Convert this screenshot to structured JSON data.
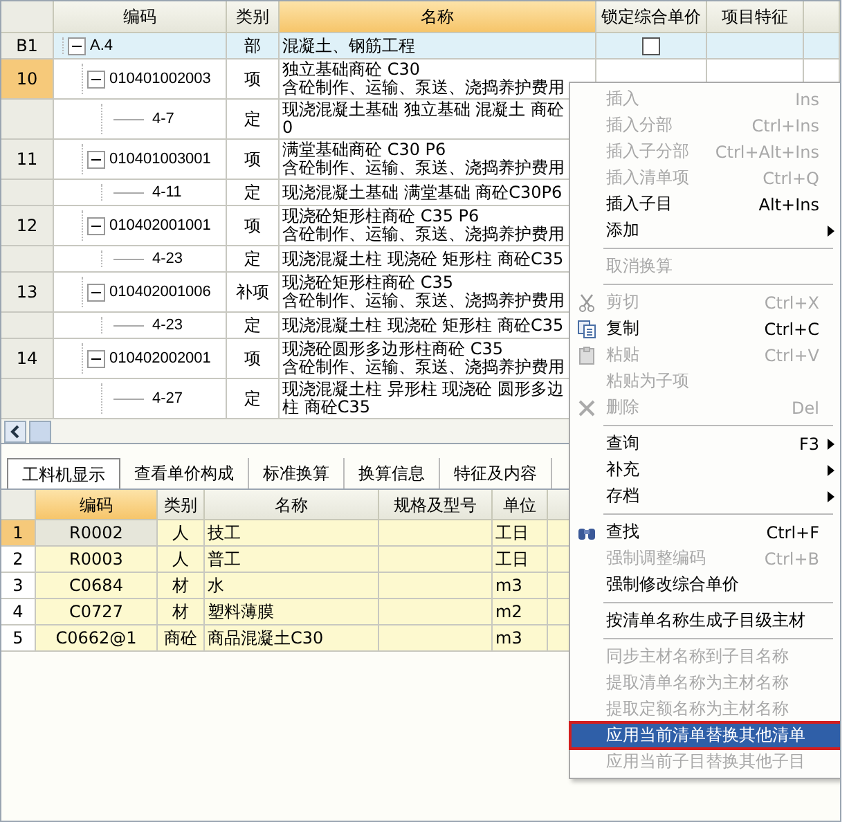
{
  "top_grid": {
    "columns": [
      {
        "label": "编码",
        "selected": false
      },
      {
        "label": "类别",
        "selected": false
      },
      {
        "label": "名称",
        "selected": true
      },
      {
        "label": "锁定综合单价",
        "selected": false
      },
      {
        "label": "项目特征",
        "selected": false
      }
    ],
    "rows": [
      {
        "row_no": "B1",
        "code": "A.4",
        "type": "部",
        "name": "混凝土、钢筋工程",
        "locked": false,
        "expanded": true,
        "selected": false,
        "children": [
          {
            "row_no": "10",
            "code": "010401002003",
            "type": "项",
            "name": "独立基础商砼 C30\n含砼制作、运输、泵送、浇捣养护费用",
            "expanded": true,
            "selected": true,
            "children": [
              {
                "code": "4-7",
                "type": "定",
                "name": "现浇混凝土基础 独立基础 混凝土 商砼\n0",
                "selected": false
              }
            ]
          },
          {
            "row_no": "11",
            "code": "010401003001",
            "type": "项",
            "name": "满堂基础商砼 C30 P6\n含砼制作、运输、泵送、浇捣养护费用",
            "expanded": true,
            "selected": false,
            "children": [
              {
                "code": "4-11",
                "type": "定",
                "name": "现浇混凝土基础 满堂基础 商砼C30P6",
                "selected": false
              }
            ]
          },
          {
            "row_no": "12",
            "code": "010402001001",
            "type": "项",
            "name": "现浇砼矩形柱商砼 C35 P6\n含砼制作、运输、泵送、浇捣养护费用",
            "expanded": true,
            "selected": false,
            "children": [
              {
                "code": "4-23",
                "type": "定",
                "name": "现浇混凝土柱 现浇砼 矩形柱 商砼C35",
                "selected": false
              }
            ]
          },
          {
            "row_no": "13",
            "code": "010402001006",
            "type": "补项",
            "name": "现浇砼矩形柱商砼 C35\n含砼制作、运输、泵送、浇捣养护费用",
            "expanded": true,
            "selected": false,
            "children": [
              {
                "code": "4-23",
                "type": "定",
                "name": "现浇混凝土柱 现浇砼 矩形柱 商砼C35",
                "selected": false
              }
            ]
          },
          {
            "row_no": "14",
            "code": "010402002001",
            "type": "项",
            "name": "现浇砼圆形多边形柱商砼 C35\n含砼制作、运输、泵送、浇捣养护费用",
            "expanded": true,
            "selected": false,
            "children": [
              {
                "code": "4-27",
                "type": "定",
                "name": "现浇混凝土柱 异形柱 现浇砼 圆形多边柱 商砼C35",
                "selected": false
              }
            ]
          }
        ]
      }
    ]
  },
  "tabs": [
    {
      "label": "工料机显示",
      "selected": true
    },
    {
      "label": "查看单价构成",
      "selected": false
    },
    {
      "label": "标准换算",
      "selected": false
    },
    {
      "label": "换算信息",
      "selected": false
    },
    {
      "label": "特征及内容",
      "selected": false
    }
  ],
  "resource_grid": {
    "columns": [
      {
        "label": "编码",
        "selected": true
      },
      {
        "label": "类别",
        "selected": false
      },
      {
        "label": "名称",
        "selected": false
      },
      {
        "label": "规格及型号",
        "selected": false
      },
      {
        "label": "单位",
        "selected": false
      }
    ],
    "rows": [
      {
        "row_no": "1",
        "code": "R0002",
        "type": "人",
        "name": "技工",
        "unit": "工日",
        "selected": true
      },
      {
        "row_no": "2",
        "code": "R0003",
        "type": "人",
        "name": "普工",
        "unit": "工日",
        "selected": false
      },
      {
        "row_no": "3",
        "code": "C0684",
        "type": "材",
        "name": "水",
        "unit": "m3",
        "selected": false
      },
      {
        "row_no": "4",
        "code": "C0727",
        "type": "材",
        "name": "塑料薄膜",
        "unit": "m2",
        "selected": false
      },
      {
        "row_no": "5",
        "code": "C0662@1",
        "type": "商砼",
        "name": "商品混凝土C30",
        "unit": "m3",
        "selected": false
      }
    ]
  },
  "context_menu": {
    "items": [
      {
        "kind": "item",
        "label": "插入",
        "shortcut": "Ins",
        "disabled": true,
        "selected": false
      },
      {
        "kind": "item",
        "label": "插入分部",
        "shortcut": "Ctrl+Ins",
        "disabled": true,
        "selected": false
      },
      {
        "kind": "item",
        "label": "插入子分部",
        "shortcut": "Ctrl+Alt+Ins",
        "disabled": true,
        "selected": false
      },
      {
        "kind": "item",
        "label": "插入清单项",
        "shortcut": "Ctrl+Q",
        "disabled": true,
        "selected": false
      },
      {
        "kind": "item",
        "label": "插入子目",
        "shortcut": "Alt+Ins",
        "disabled": false,
        "selected": false
      },
      {
        "kind": "submenu",
        "label": "添加",
        "disabled": false,
        "selected": false
      },
      {
        "kind": "separator"
      },
      {
        "kind": "item",
        "label": "取消换算",
        "disabled": true,
        "selected": false
      },
      {
        "kind": "separator"
      },
      {
        "kind": "item",
        "label": "剪切",
        "shortcut": "Ctrl+X",
        "disabled": true,
        "selected": false
      },
      {
        "kind": "item",
        "label": "复制",
        "shortcut": "Ctrl+C",
        "disabled": false,
        "selected": false
      },
      {
        "kind": "item",
        "label": "粘贴",
        "shortcut": "Ctrl+V",
        "disabled": true,
        "selected": false
      },
      {
        "kind": "item",
        "label": "粘贴为子项",
        "disabled": true,
        "selected": false
      },
      {
        "kind": "item",
        "label": "删除",
        "shortcut": "Del",
        "disabled": true,
        "selected": false
      },
      {
        "kind": "separator"
      },
      {
        "kind": "submenu",
        "label": "查询",
        "shortcut": "F3",
        "disabled": false,
        "selected": false
      },
      {
        "kind": "submenu",
        "label": "补充",
        "disabled": false,
        "selected": false
      },
      {
        "kind": "submenu",
        "label": "存档",
        "disabled": false,
        "selected": false
      },
      {
        "kind": "separator"
      },
      {
        "kind": "item",
        "label": "查找",
        "shortcut": "Ctrl+F",
        "disabled": false,
        "selected": false
      },
      {
        "kind": "item",
        "label": "强制调整编码",
        "shortcut": "Ctrl+B",
        "disabled": true,
        "selected": false
      },
      {
        "kind": "item",
        "label": "强制修改综合单价",
        "disabled": false,
        "selected": false
      },
      {
        "kind": "separator"
      },
      {
        "kind": "item",
        "label": "按清单名称生成子目级主材",
        "disabled": false,
        "selected": false
      },
      {
        "kind": "separator"
      },
      {
        "kind": "item",
        "label": "同步主材名称到子目名称",
        "disabled": true,
        "selected": false
      },
      {
        "kind": "item",
        "label": "提取清单名称为主材名称",
        "disabled": true,
        "selected": false
      },
      {
        "kind": "item",
        "label": "提取定额名称为主材名称",
        "disabled": true,
        "selected": false
      },
      {
        "kind": "item",
        "label": "应用当前清单替换其他清单",
        "disabled": false,
        "selected": true
      },
      {
        "kind": "item",
        "label": "应用当前子目替换其他子目",
        "disabled": true,
        "selected": false
      }
    ]
  }
}
